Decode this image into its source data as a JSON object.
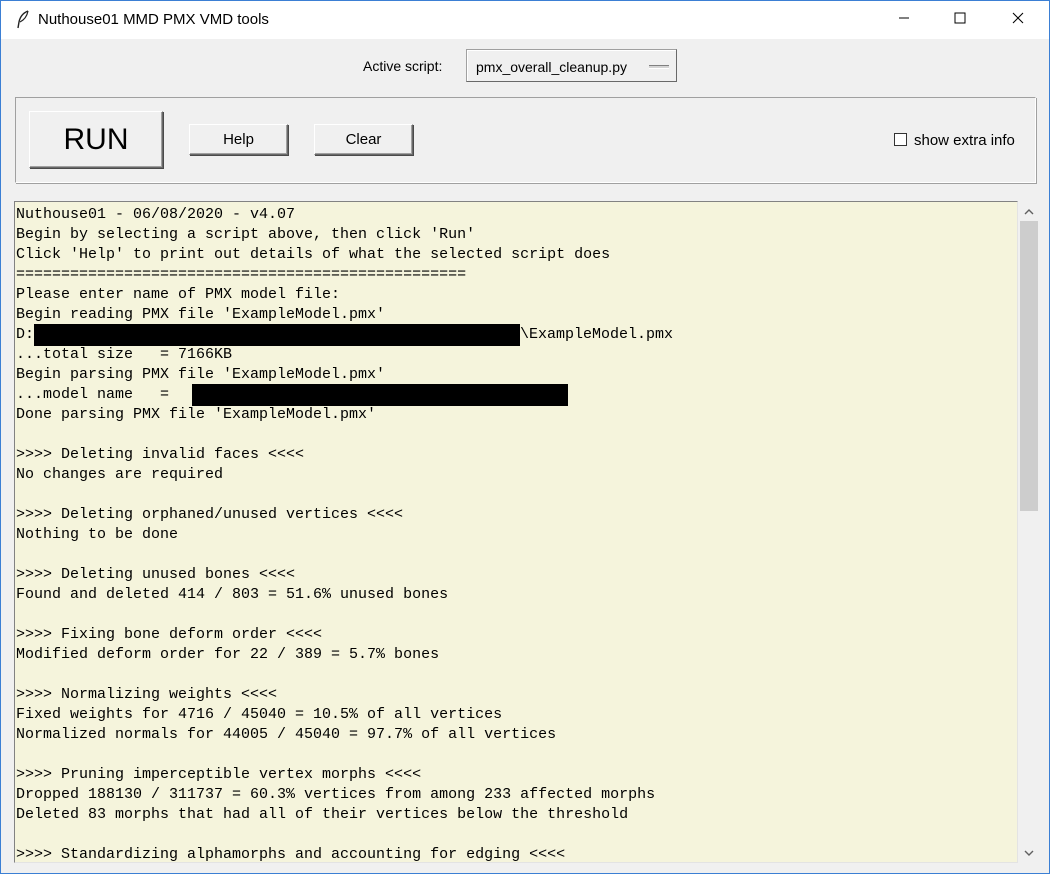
{
  "window": {
    "title": "Nuthouse01 MMD PMX VMD tools"
  },
  "script_selector": {
    "label": "Active script:",
    "selected": "pmx_overall_cleanup.py"
  },
  "toolbar": {
    "run_label": "RUN",
    "help_label": "Help",
    "clear_label": "Clear",
    "extra_info_label": "show extra info",
    "extra_info_checked": false
  },
  "console": {
    "lines": [
      "Nuthouse01 - 06/08/2020 - v4.07",
      "Begin by selecting a script above, then click 'Run'",
      "Click 'Help' to print out details of what the selected script does",
      "==================================================",
      "Please enter name of PMX model file:",
      "Begin reading PMX file 'ExampleModel.pmx'",
      "D:",
      "...total size   = 7166KB",
      "Begin parsing PMX file 'ExampleModel.pmx'",
      "...model name   = ",
      "Done parsing PMX file 'ExampleModel.pmx'",
      "",
      ">>>> Deleting invalid faces <<<<",
      "No changes are required",
      "",
      ">>>> Deleting orphaned/unused vertices <<<<",
      "Nothing to be done",
      "",
      ">>>> Deleting unused bones <<<<",
      "Found and deleted 414 / 803 = 51.6% unused bones",
      "",
      ">>>> Fixing bone deform order <<<<",
      "Modified deform order for 22 / 389 = 5.7% bones",
      "",
      ">>>> Normalizing weights <<<<",
      "Fixed weights for 4716 / 45040 = 10.5% of all vertices",
      "Normalized normals for 44005 / 45040 = 97.7% of all vertices",
      "",
      ">>>> Pruning imperceptible vertex morphs <<<<",
      "Dropped 188130 / 311737 = 60.3% vertices from among 233 affected morphs",
      "Deleted 83 morphs that had all of their vertices below the threshold",
      "",
      ">>>> Standardizing alphamorphs and accounting for edging <<<<"
    ],
    "path_suffix": "\\ExampleModel.pmx"
  },
  "colors": {
    "console_bg": "#f5f4dc",
    "window_border": "#3b7fd4",
    "chrome_bg": "#f0f0f0"
  },
  "icons": {
    "title": "feather-icon",
    "minimize": "minimize-icon",
    "maximize": "maximize-icon",
    "close": "close-icon",
    "scroll_up": "chevron-up-icon",
    "scroll_down": "chevron-down-icon"
  }
}
